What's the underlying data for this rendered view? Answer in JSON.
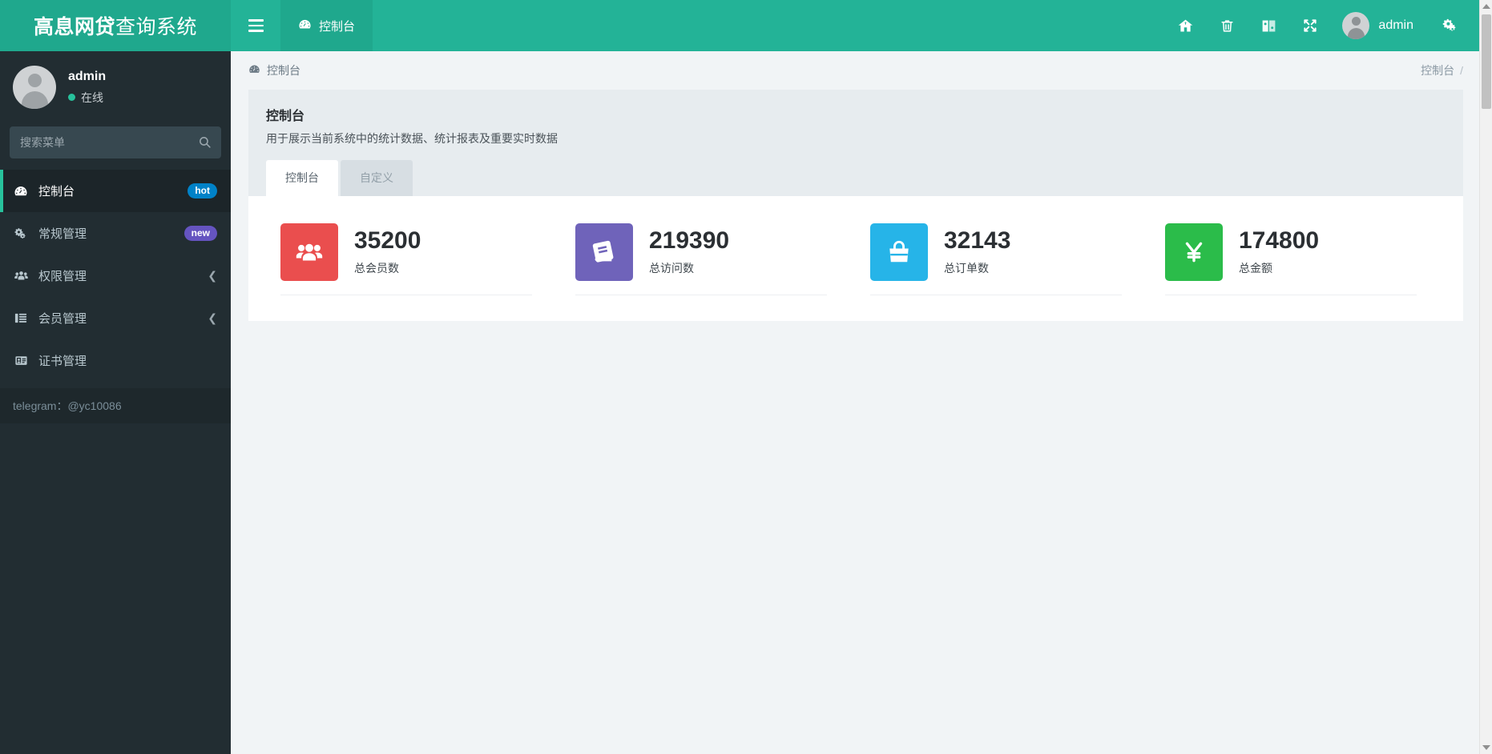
{
  "app": {
    "logo_strong": "高息网贷",
    "logo_light": "查询系统",
    "brand_color": "#23b397",
    "sidebar_color": "#222d32"
  },
  "topbar": {
    "hamburger_name": "menu-toggle",
    "tab_label": "控制台",
    "icons": [
      "home-icon",
      "trash-icon",
      "theme-icon",
      "fullscreen-icon",
      "gears-icon"
    ],
    "user_name": "admin"
  },
  "sidebar": {
    "profile": {
      "name": "admin",
      "status": "在线"
    },
    "search": {
      "placeholder": "搜索菜单",
      "value": ""
    },
    "items": [
      {
        "label": "控制台",
        "icon": "dashboard-icon",
        "badge": "hot",
        "badge_type": "hot",
        "active": true,
        "chevron": false
      },
      {
        "label": "常规管理",
        "icon": "cogs-icon",
        "badge": "new",
        "badge_type": "new",
        "active": false,
        "chevron": false
      },
      {
        "label": "权限管理",
        "icon": "users-icon",
        "badge": "",
        "badge_type": "",
        "active": false,
        "chevron": true
      },
      {
        "label": "会员管理",
        "icon": "list-icon",
        "badge": "",
        "badge_type": "",
        "active": false,
        "chevron": true
      },
      {
        "label": "证书管理",
        "icon": "id-card-icon",
        "badge": "",
        "badge_type": "",
        "active": false,
        "chevron": false
      }
    ],
    "footer": "telegram：@yc10086"
  },
  "breadcrumb": {
    "left": "控制台",
    "right": "控制台",
    "separator": "/"
  },
  "panel": {
    "title": "控制台",
    "subtitle": "用于展示当前系统中的统计数据、统计报表及重要实时数据",
    "tabs": [
      {
        "label": "控制台",
        "active": true
      },
      {
        "label": "自定义",
        "active": false
      }
    ]
  },
  "stats": [
    {
      "value": "35200",
      "label": "总会员数",
      "color": "#ea4e4e",
      "icon": "users-group-icon"
    },
    {
      "value": "219390",
      "label": "总访问数",
      "color": "#6f63ba",
      "icon": "book-icon"
    },
    {
      "value": "32143",
      "label": "总订单数",
      "color": "#26b4e8",
      "icon": "shopping-bag-icon"
    },
    {
      "value": "174800",
      "label": "总金额",
      "color": "#2bbc4a",
      "icon": "yen-icon"
    }
  ]
}
